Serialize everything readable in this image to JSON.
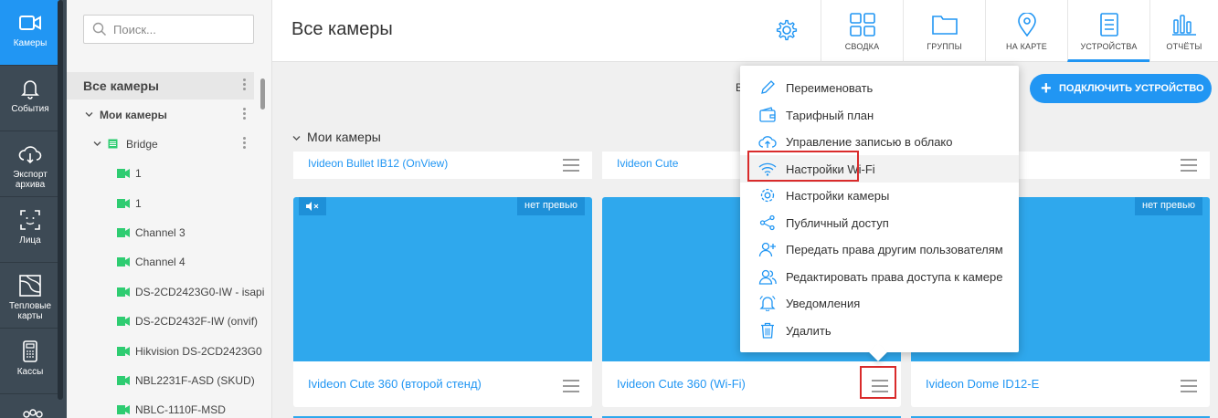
{
  "rail": {
    "items": [
      {
        "label": "Камеры",
        "icon": "camera-icon"
      },
      {
        "label": "События",
        "icon": "bell-icon"
      },
      {
        "label": "Экспорт архива",
        "icon": "cloud-download-icon"
      },
      {
        "label": "Лица",
        "icon": "face-icon"
      },
      {
        "label": "Тепловые карты",
        "icon": "heatmap-icon"
      },
      {
        "label": "Кассы",
        "icon": "cash-register-icon"
      }
    ]
  },
  "tree": {
    "search_placeholder": "Поиск...",
    "all_cameras": "Все камеры",
    "my_cameras": "Мои камеры",
    "bridge": "Bridge",
    "items": [
      "1",
      "1",
      "Channel 3",
      "Channel 4",
      "DS-2CD2423G0-IW - isapi",
      "DS-2CD2432F-IW (onvif)",
      "Hikvision DS-2CD2423G0",
      "NBL2231F-ASD (SKUD)",
      "NBLC-1110F-MSD"
    ]
  },
  "header": {
    "title": "Все камеры",
    "nav": [
      {
        "label": "СВОДКА",
        "icon": "grid-icon"
      },
      {
        "label": "ГРУППЫ",
        "icon": "folder-icon"
      },
      {
        "label": "НА КАРТЕ",
        "icon": "map-pin-icon"
      },
      {
        "label": "УСТРОЙСТВА",
        "icon": "devices-icon"
      },
      {
        "label": "ОТЧЁТЫ",
        "icon": "reports-icon"
      }
    ]
  },
  "main": {
    "connect_label": "ПОДКЛЮЧИТЬ УСТРОЙСТВО",
    "behind_text": "В",
    "group_title": "Мои камеры",
    "top_cards": [
      "Ivideon Bullet IB12 (OnView)",
      "Ivideon Cute",
      ""
    ],
    "cards": [
      {
        "name": "Ivideon Cute 360 (второй стенд)",
        "badge": "нет превью"
      },
      {
        "name": "Ivideon Cute 360 (Wi-Fi)",
        "badge": ""
      },
      {
        "name": "Ivideon Dome ID12-E",
        "badge": "нет превью"
      }
    ]
  },
  "menu": {
    "items": [
      {
        "label": "Переименовать",
        "icon": "pencil-icon"
      },
      {
        "label": "Тарифный план",
        "icon": "wallet-icon"
      },
      {
        "label": "Управление записью в облако",
        "icon": "cloud-upload-icon"
      },
      {
        "label": "Настройки Wi-Fi",
        "icon": "wifi-icon"
      },
      {
        "label": "Настройки камеры",
        "icon": "gear-icon"
      },
      {
        "label": "Публичный доступ",
        "icon": "share-icon"
      },
      {
        "label": "Передать права другим пользователям",
        "icon": "user-add-icon"
      },
      {
        "label": "Редактировать права доступа к камере",
        "icon": "users-icon"
      },
      {
        "label": "Уведомления",
        "icon": "bell-icon"
      },
      {
        "label": "Удалить",
        "icon": "trash-icon"
      }
    ]
  },
  "colors": {
    "accent": "#2196f3",
    "rail": "#3d4a55",
    "preview": "#2fa8ed",
    "highlight": "#d92b2b",
    "tree_camera": "#2ecc71"
  }
}
